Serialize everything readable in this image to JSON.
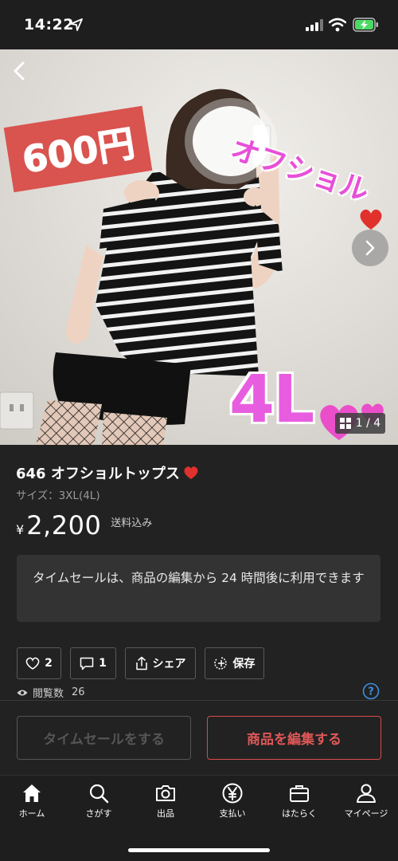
{
  "status_bar": {
    "time": "14:22"
  },
  "hero": {
    "price_overlay": "600円",
    "offshoulder_overlay": "オフショル",
    "size_overlay": "4L",
    "page_counter": "1 / 4"
  },
  "product": {
    "title": "646 オフショルトップス",
    "size": "サイズ：3XL(4L)",
    "currency": "¥",
    "price": "2,200",
    "shipping": "送料込み"
  },
  "notice": {
    "text": "タイムセールは、商品の編集から 24 時間後に利用できます"
  },
  "actions": {
    "like_count": "2",
    "comment_count": "1",
    "share_label": "シェア",
    "save_label": "保存"
  },
  "views": {
    "label": "閲覧数",
    "count": "26"
  },
  "buttons": {
    "timesale": "タイムセールをする",
    "edit": "商品を編集する"
  },
  "tabs": [
    {
      "label": "ホーム",
      "icon": "home-icon"
    },
    {
      "label": "さがす",
      "icon": "search-icon"
    },
    {
      "label": "出品",
      "icon": "camera-icon"
    },
    {
      "label": "支払い",
      "icon": "yen-icon"
    },
    {
      "label": "はたらく",
      "icon": "briefcase-icon"
    },
    {
      "label": "マイページ",
      "icon": "person-icon"
    }
  ],
  "colors": {
    "background": "#222222",
    "accent_red": "#e05757",
    "price_tag": "#d9534f",
    "overlay_pink": "#e84fd8"
  }
}
